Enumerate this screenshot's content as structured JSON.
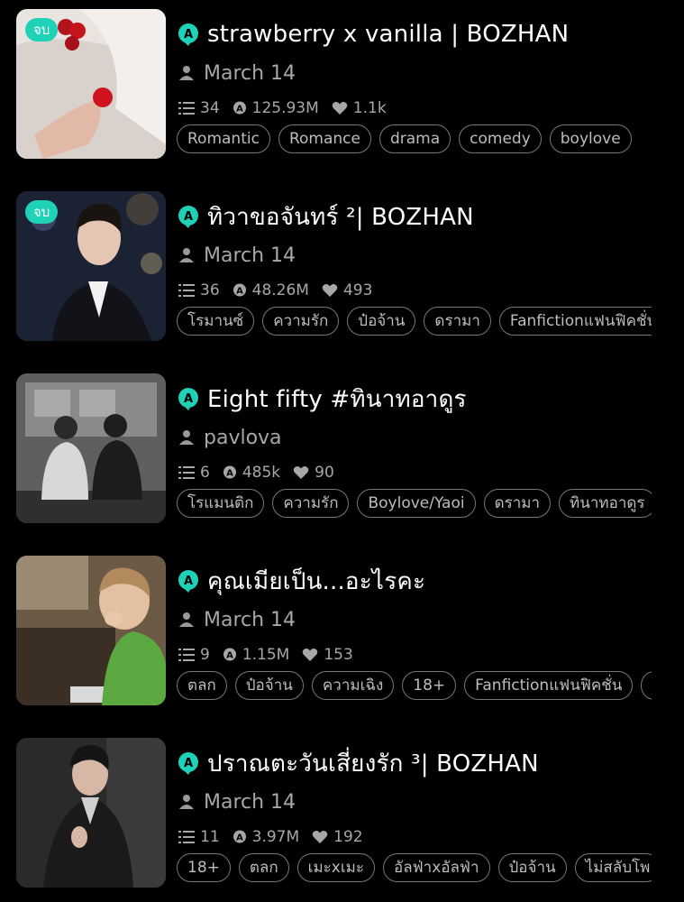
{
  "colors": {
    "accent": "#1fd1b7",
    "background": "#000000",
    "muted": "#a7a7a7",
    "tag_border": "#777777"
  },
  "stories": [
    {
      "badge": "จบ",
      "title": "strawberry x vanilla | BOZHAN",
      "author": "March 14",
      "chapters": "34",
      "reads": "125.93M",
      "likes": "1.1k",
      "tags": [
        "Romantic",
        "Romance",
        "drama",
        "comedy",
        "boylove"
      ]
    },
    {
      "badge": "จบ",
      "title": "ทิวาขอจันทร์ ²| BOZHAN",
      "author": "March 14",
      "chapters": "36",
      "reads": "48.26M",
      "likes": "493",
      "tags": [
        "โรมานซ์",
        "ความรัก",
        "ป๋อจ้าน",
        "ดรามา",
        "Fanfictionแฟนฟิคชั่น"
      ]
    },
    {
      "badge": "",
      "title": "Eight fifty #ทินาทอาดูร",
      "author": "pavlova",
      "chapters": "6",
      "reads": "485k",
      "likes": "90",
      "tags": [
        "โรแมนติก",
        "ความรัก",
        "Boylove/Yaoi",
        "ดรามา",
        "ทินาทอาดูร"
      ]
    },
    {
      "badge": "",
      "title": "คุณเมียเป็น...อะไรคะ",
      "author": "March 14",
      "chapters": "9",
      "reads": "1.15M",
      "likes": "153",
      "tags": [
        "ตลก",
        "ป๋อจ้าน",
        "ความเฉิง",
        "18+",
        "Fanfictionแฟนฟิคชั่น",
        "("
      ]
    },
    {
      "badge": "",
      "title": "ปราณตะวันเสี่ยงรัก ³| BOZHAN",
      "author": "March 14",
      "chapters": "11",
      "reads": "3.97M",
      "likes": "192",
      "tags": [
        "18+",
        "ตลก",
        "เมะxเมะ",
        "อัลฟ่าxอัลฟ่า",
        "ป๋อจ้าน",
        "ไม่สลับโพ"
      ]
    }
  ]
}
